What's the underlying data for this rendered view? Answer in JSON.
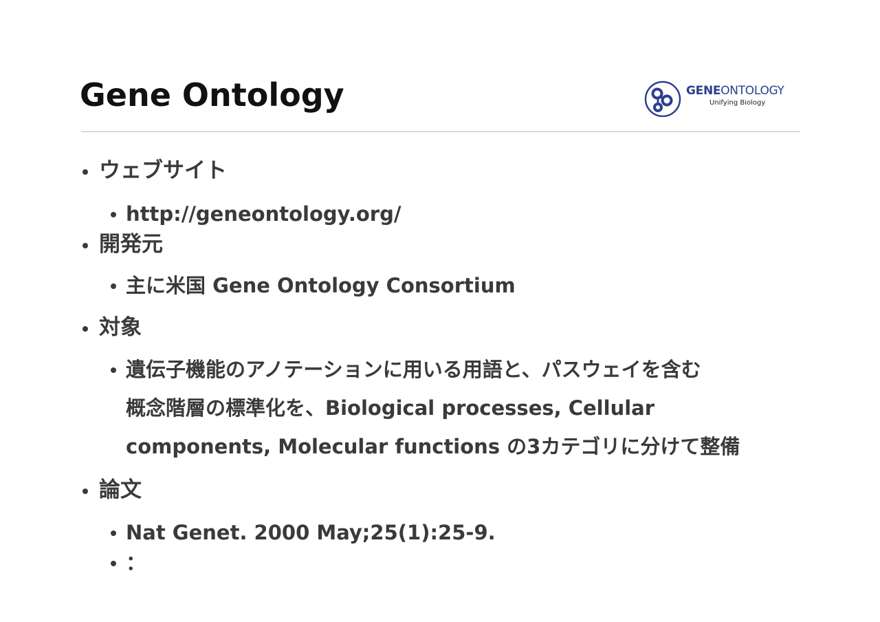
{
  "title": "Gene Ontology",
  "logo": {
    "icon": "gene-ontology-logo-icon",
    "gene": "GENE",
    "ontology": "ONTOLOGY",
    "tagline": "Unifying Biology",
    "color": "#2c3f8f"
  },
  "items": [
    {
      "label": "ウェブサイト",
      "sub": [
        "http://geneontology.org/"
      ]
    },
    {
      "label": "開発元",
      "sub": [
        "主に米国 Gene Ontology Consortium"
      ]
    },
    {
      "label": "対象",
      "sub_lines": [
        "遺伝子機能のアノテーションに用いる用語と、パスウェイを含む",
        "概念階層の標準化を、Biological processes, Cellular",
        "components, Molecular functions の3カテゴリに分けて整備"
      ]
    },
    {
      "label": "論文",
      "sub": [
        "Nat Genet. 2000 May;25(1):25-9.",
        "："
      ]
    }
  ]
}
